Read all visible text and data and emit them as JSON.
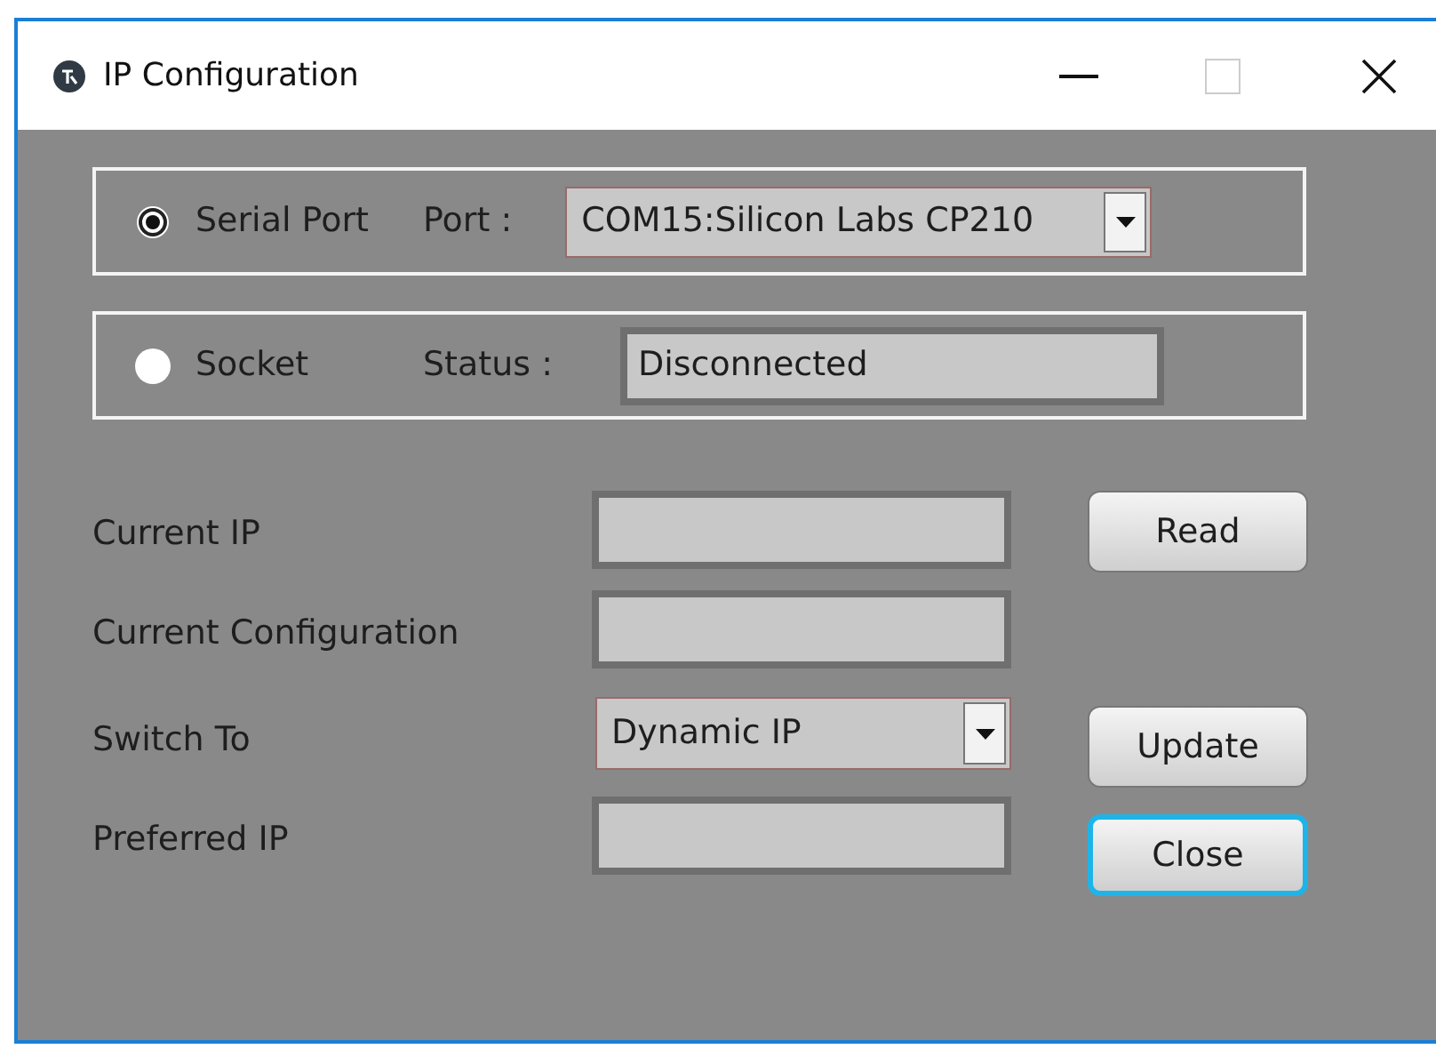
{
  "window": {
    "title": "IP Configuration"
  },
  "connections": [
    {
      "label": "Serial Port",
      "selected": true,
      "field_label": "Port :",
      "kind": "dropdown",
      "value": "COM15:Silicon Labs CP210"
    },
    {
      "label": "Socket",
      "selected": false,
      "field_label": "Status :",
      "kind": "field",
      "value": "Disconnected"
    }
  ],
  "form_rows": [
    {
      "label": "Current IP",
      "kind": "field"
    },
    {
      "label": "Current Configuration",
      "kind": "field"
    },
    {
      "label": "Switch To",
      "kind": "dropdown",
      "value": "Dynamic IP"
    },
    {
      "label": "Preferred IP",
      "kind": "field"
    }
  ],
  "buttons": [
    {
      "label": "Read",
      "focused": false
    },
    {
      "label": "Update",
      "focused": false
    },
    {
      "label": "Close",
      "focused": true
    }
  ]
}
